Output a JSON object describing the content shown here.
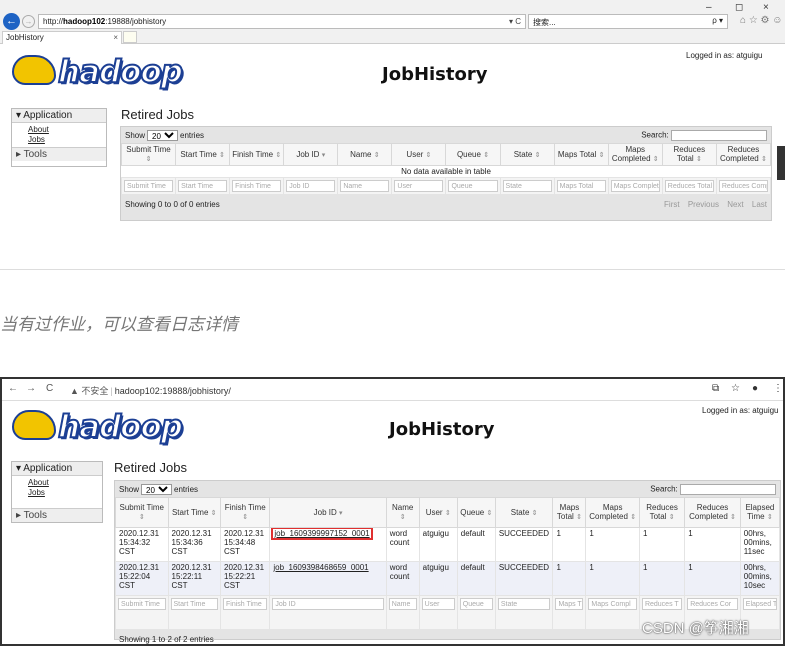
{
  "shot1": {
    "browser": {
      "url_prefix": "http://",
      "url_host": "hadoop102",
      "url_rest": ":19888/jobhistory",
      "url_controls": "▾ C",
      "search_placeholder": "搜索...",
      "search_control": "ρ ▾",
      "tab_title": "JobHistory",
      "tab_close": "×",
      "window_controls": [
        "–",
        "◻",
        "×"
      ],
      "toolbar_icons": "⌂ ☆ ⚙ ☺"
    },
    "logo_text": "hadoop",
    "page_title": "JobHistory",
    "logged_in": "Logged in as: atguigu",
    "sidebar": {
      "application": "▾ Application",
      "links": [
        "About",
        "Jobs"
      ],
      "tools": "▸ Tools"
    },
    "section_title": "Retired Jobs",
    "show_prefix": "Show",
    "show_value": "20",
    "show_suffix": "entries",
    "search_label": "Search:",
    "columns": [
      "Submit Time",
      "Start Time",
      "Finish Time",
      "Job ID",
      "Name",
      "User",
      "Queue",
      "State",
      "Maps Total",
      "Maps Completed",
      "Reduces Total",
      "Reduces Completed"
    ],
    "empty_message": "No data available in table",
    "filters": [
      "Submit Time",
      "Start Time",
      "Finish Time",
      "Job ID",
      "Name",
      "User",
      "Queue",
      "State",
      "Maps Total",
      "Maps Completed",
      "Reduces Total",
      "Reduces Compl"
    ],
    "footer": "Showing 0 to 0 of 0 entries",
    "pager": [
      "First",
      "Previous",
      "Next",
      "Last"
    ]
  },
  "caption": "当有过作业，可以查看日志详情",
  "shot2": {
    "browser": {
      "nav": [
        "←",
        "→",
        "C"
      ],
      "insecure": "▲ 不安全",
      "url": "hadoop102:19888/jobhistory/",
      "right_icons": [
        "⧉",
        "☆",
        "●",
        "⋮"
      ]
    },
    "logo_text": "hadoop",
    "page_title": "JobHistory",
    "logged_in": "Logged in as: atguigu",
    "sidebar": {
      "application": "▾ Application",
      "links": [
        "About",
        "Jobs"
      ],
      "tools": "▸ Tools"
    },
    "section_title": "Retired Jobs",
    "show_prefix": "Show",
    "show_value": "20",
    "show_suffix": "entries",
    "search_label": "Search:",
    "columns": [
      "Submit Time",
      "Start Time",
      "Finish Time",
      "Job ID",
      "Name",
      "User",
      "Queue",
      "State",
      "Maps Total",
      "Maps Completed",
      "Reduces Total",
      "Reduces Completed",
      "Elapsed Time"
    ],
    "rows": [
      {
        "submit": "2020.12.31 15:34:32 CST",
        "start": "2020.12.31 15:34:36 CST",
        "finish": "2020.12.31 15:34:48 CST",
        "job_id": "job_1609399997152_0001",
        "name": "word count",
        "user": "atguigu",
        "queue": "default",
        "state": "SUCCEEDED",
        "maps_total": "1",
        "maps_completed": "1",
        "reduces_total": "1",
        "reduces_completed": "1",
        "elapsed": "00hrs, 00mins, 11sec"
      },
      {
        "submit": "2020.12.31 15:22:04 CST",
        "start": "2020.12.31 15:22:11 CST",
        "finish": "2020.12.31 15:22:21 CST",
        "job_id": "job_1609398468659_0001",
        "name": "word count",
        "user": "atguigu",
        "queue": "default",
        "state": "SUCCEEDED",
        "maps_total": "1",
        "maps_completed": "1",
        "reduces_total": "1",
        "reduces_completed": "1",
        "elapsed": "00hrs, 00mins, 10sec"
      }
    ],
    "filters": [
      "Submit Time",
      "Start Time",
      "Finish Time",
      "Job ID",
      "Name",
      "User",
      "Queue",
      "State",
      "Maps T",
      "Maps Compl",
      "Reduces T",
      "Reduces Cor",
      "Elapsed T"
    ],
    "footer": "Showing 1 to 2 of 2 entries"
  },
  "watermark": "CSDN @筝湘湘",
  "colors": {
    "highlight_box": "#e03030",
    "logo_blue": "#1c3f94",
    "logo_yellow": "#f2c400",
    "ie_back_button": "#1e63c4"
  }
}
